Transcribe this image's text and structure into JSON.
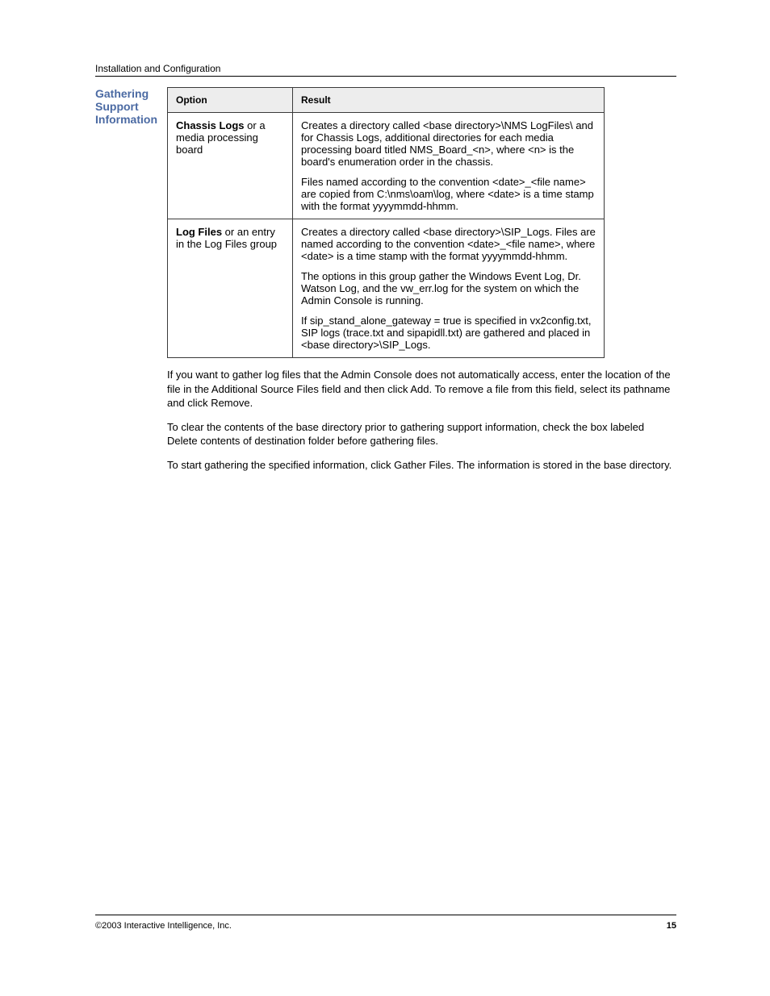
{
  "header": {
    "section": "Installation and Configuration"
  },
  "sidebar": {
    "heading": "Gathering Support Information"
  },
  "table": {
    "headers": [
      "Option",
      "Result"
    ],
    "rows": [
      {
        "option_bold": "Chassis Logs",
        "option_rest": " or a media processing board",
        "paragraphs": [
          "Creates a directory called <base directory>\\NMS LogFiles\\ and for Chassis Logs, additional directories for each media processing board titled NMS_Board_<n>, where <n> is the board's enumeration order in the chassis.",
          "Files named according to the convention <date>_<file name> are copied from C:\\nms\\oam\\log, where <date> is a time stamp with the format yyyymmdd-hhmm."
        ]
      },
      {
        "option_bold": "Log Files",
        "option_rest": " or an entry in the Log Files group",
        "paragraphs": [
          "Creates a directory called <base directory>\\SIP_Logs. Files are named according to the convention <date>_<file name>, where <date> is a time stamp with the format yyyymmdd-hhmm.",
          "The options in this group gather the Windows Event Log, Dr. Watson Log, and the vw_err.log for the system on which the Admin Console is running.",
          "If sip_stand_alone_gateway = true is specified in vx2config.txt, SIP logs (trace.txt and sipapidll.txt) are gathered and placed in <base directory>\\SIP_Logs."
        ]
      }
    ]
  },
  "body": {
    "paragraphs": [
      "If you want to gather log files that the Admin Console does not automatically access, enter the location of the file in the Additional Source Files field and then click Add. To remove a file from this field, select its pathname and click Remove.",
      "To clear the contents of the base directory prior to gathering support information, check the box labeled Delete contents of destination folder before gathering files.",
      "To start gathering the specified information, click Gather Files. The information is stored in the base directory."
    ]
  },
  "footer": {
    "left": "©2003 Interactive Intelligence, Inc.",
    "right": "15"
  }
}
